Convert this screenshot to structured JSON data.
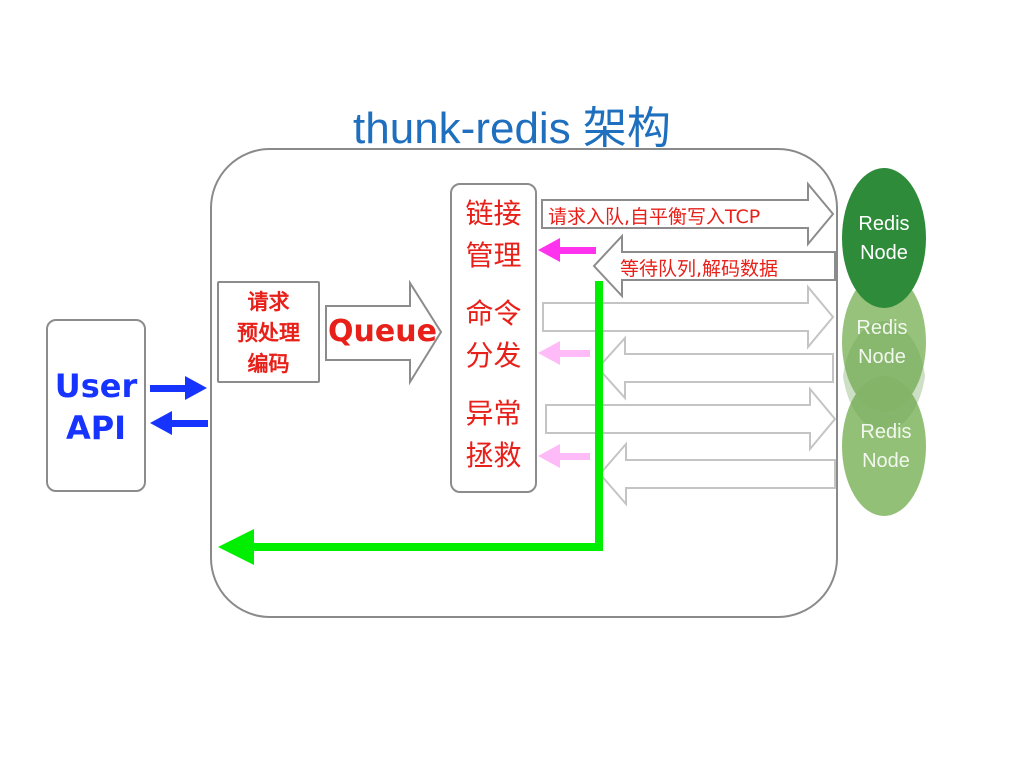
{
  "title": "thunk-redis 架构",
  "user_api": {
    "line1": "User",
    "line2": "API"
  },
  "preprocess": {
    "line1": "请求",
    "line2": "预处理",
    "line3": "编码"
  },
  "queue": "Queue",
  "manager": {
    "connection": [
      "链接",
      "管理"
    ],
    "dispatch": [
      "命令",
      "分发"
    ],
    "rescue": [
      "异常",
      "拯救"
    ]
  },
  "arrows": {
    "request": "请求入队,自平衡写入TCP",
    "response": "等待队列,解码数据"
  },
  "redis_nodes": [
    {
      "label": "Redis Node",
      "line1": "Redis",
      "line2": "Node"
    },
    {
      "label": "Redis Node",
      "line1": "Redis",
      "line2": "Node"
    },
    {
      "label": "Redis Node",
      "line1": "Redis",
      "line2": "Node"
    }
  ],
  "colors": {
    "title": "#1f6fbf",
    "user_api": "#1734ff",
    "red_text": "#e8201a",
    "green_return": "#00ee00",
    "node_dark": "#2e8b3a",
    "node_light": "#8dbd70",
    "magenta": "#ff33ee",
    "pink": "#ffbbf7"
  }
}
